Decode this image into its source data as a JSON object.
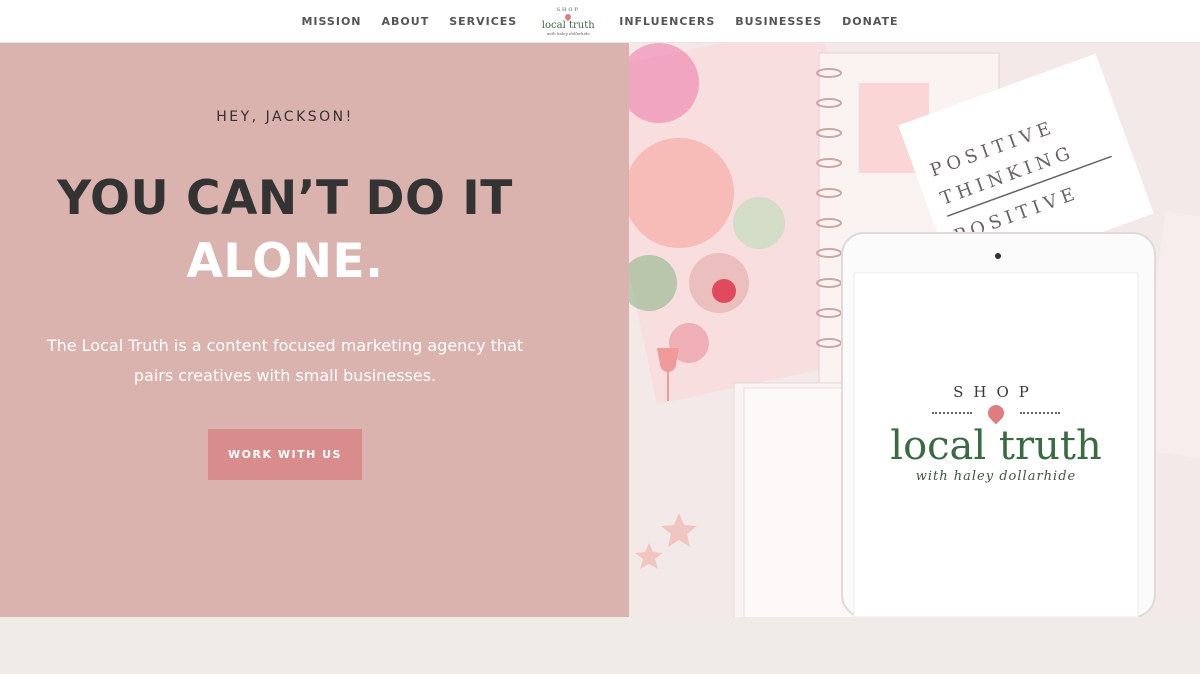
{
  "nav": {
    "left_items": [
      "MISSION",
      "ABOUT",
      "SERVICES"
    ],
    "right_items": [
      "INFLUENCERS",
      "BUSINESSES",
      "DONATE"
    ],
    "logo": {
      "shop": "SHOP",
      "name": "local truth",
      "tagline": "with haley dollarhide"
    }
  },
  "hero": {
    "greeting": "HEY, JACKSON!",
    "headline_dark": "YOU CAN’T DO IT",
    "headline_light": "ALONE.",
    "description": "The Local Truth is a content focused marketing agency that pairs creatives with small businesses.",
    "cta_label": "WORK WITH US"
  },
  "photo": {
    "card_text": [
      "POSITIVE",
      "THINKING",
      "POSITIVE"
    ],
    "tablet_logo": {
      "shop": "SHOP",
      "name": "local truth",
      "tagline": "with haley dollarhide"
    }
  },
  "colors": {
    "hero_bg": "#dab2ae",
    "cta_bg": "#d98c8c",
    "logo_green": "#3b6b43",
    "pin_pink": "#e07b80"
  }
}
